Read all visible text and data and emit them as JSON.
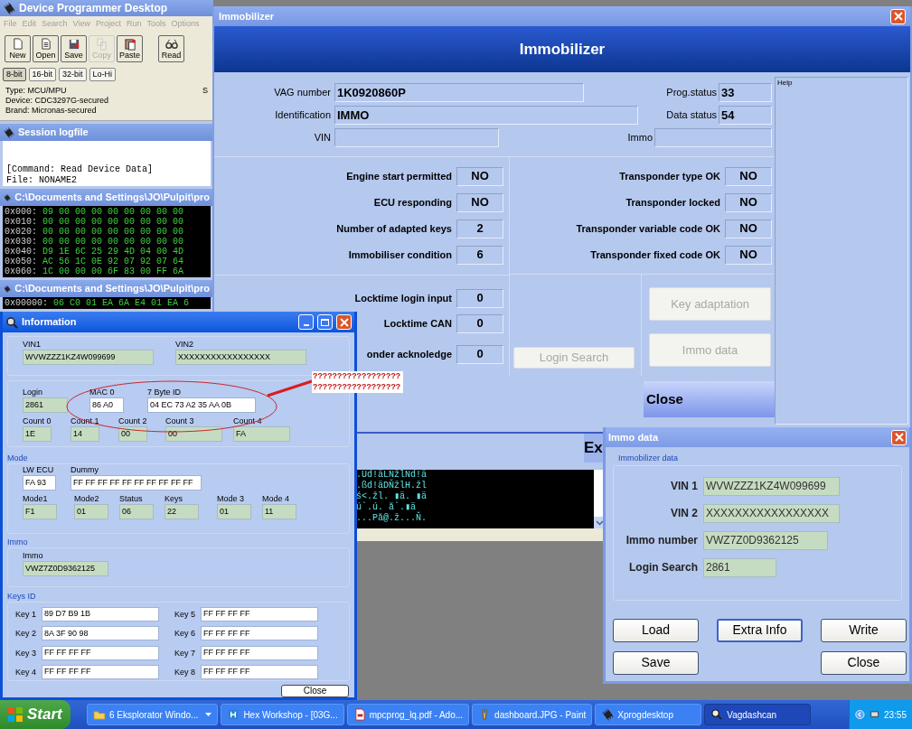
{
  "programmer_window": {
    "title": "Device Programmer Desktop",
    "menu": [
      {
        "label": "File",
        "disabled": true
      },
      {
        "label": "Edit",
        "disabled": true
      },
      {
        "label": "Search",
        "disabled": true
      },
      {
        "label": "View",
        "disabled": true
      },
      {
        "label": "Project",
        "disabled": true
      },
      {
        "label": "Run",
        "disabled": true
      },
      {
        "label": "Tools",
        "disabled": true
      },
      {
        "label": "Options",
        "disabled": true
      }
    ],
    "toolbar": [
      {
        "kind": "new",
        "label": "New",
        "disabled": false
      },
      {
        "kind": "open",
        "label": "Open",
        "disabled": false
      },
      {
        "kind": "save",
        "label": "Save",
        "disabled": false
      },
      {
        "kind": "copy",
        "label": "Copy",
        "disabled": true
      },
      {
        "kind": "paste",
        "label": "Paste",
        "disabled": false
      },
      {
        "kind": "read",
        "label": "Read",
        "disabled": false
      }
    ],
    "width_buttons": [
      {
        "label": "8-bit",
        "selected": true
      },
      {
        "label": "16-bit",
        "selected": false
      },
      {
        "label": "32-bit",
        "selected": false
      },
      {
        "label": "Lo-Hi",
        "selected": false
      }
    ],
    "device_info": [
      "Type: MCU/MPU",
      "Device: CDC3297G-secured",
      "Brand: Micronas-secured"
    ],
    "info_column_2": "S",
    "session_log": {
      "title": "Session logfile",
      "lines": [
        "[Command: Read Device Data]",
        "File: NONAME2"
      ]
    },
    "hex_panels": [
      {
        "title": "C:\\Documents and Settings\\JO\\Pulpit\\pro",
        "rows": [
          {
            "address": "0x000:",
            "bytes": "09 00 00 00 00 00 00 00 00"
          },
          {
            "address": "0x010:",
            "bytes": "00 00 00 00 00 00 00 00 00"
          },
          {
            "address": "0x020:",
            "bytes": "00 00 00 00 00 00 00 00 00"
          },
          {
            "address": "0x030:",
            "bytes": "00 00 00 00 00 00 00 00 00"
          },
          {
            "address": "0x040:",
            "bytes": "D9 1E 6C 25 29 4D 04 00 4D"
          },
          {
            "address": "0x050:",
            "bytes": "AC 56 1C 0E 92 07 92 07 64"
          },
          {
            "address": "0x060:",
            "bytes": "1C 00 00 00 6F 83 00 FF 6A"
          }
        ]
      },
      {
        "title": "C:\\Documents and Settings\\JO\\Pulpit\\pro",
        "rows": [
          {
            "address": "0x00000:",
            "bytes": "06 C0 01 EA 6A E4 01 EA 6"
          }
        ]
      }
    ]
  },
  "immobilizer": {
    "title": "Immobilizer",
    "heading": "Immobilizer",
    "identity": [
      {
        "label": "VAG number",
        "value": "1K0920860P"
      },
      {
        "label": "Identification",
        "value": "IMMO"
      },
      {
        "label": "VIN"
      }
    ],
    "status": [
      {
        "label": "Prog.status",
        "value": "33"
      },
      {
        "label": "Data status",
        "value": "54"
      },
      {
        "label": "Immo"
      }
    ],
    "help": "Help",
    "conditions": [
      {
        "label": "Engine start permitted",
        "value": "NO"
      },
      {
        "label": "ECU responding",
        "value": "NO"
      },
      {
        "label": "Number of adapted keys",
        "value": "2"
      },
      {
        "label": "Immobiliser condition",
        "value": "6"
      }
    ],
    "transponder": [
      {
        "label": "Transponder type OK",
        "value": "NO"
      },
      {
        "label": "Transponder locked",
        "value": "NO"
      },
      {
        "label": "Transponder variable code OK",
        "value": "NO"
      },
      {
        "label": "Transponder fixed code OK",
        "value": "NO"
      }
    ],
    "locktimes": [
      {
        "label": "Locktime login input",
        "value": "0"
      },
      {
        "label": "Locktime CAN",
        "value": "0"
      },
      {
        "label": "onder acknoledge",
        "value": "0"
      }
    ],
    "login_search": {
      "label": "Login Search",
      "disabled": true
    },
    "actions": [
      {
        "label": "Key adaptation",
        "disabled": true
      },
      {
        "label": "Immo data",
        "disabled": true
      }
    ],
    "close": "Close"
  },
  "background_window": {
    "button_cut": "Ex",
    "data_lines": [
      ".Ud!äLNžlNd!ä",
      ".ßd!äDŇžlH.žl",
      "ś<.žl. ▮ä. ▮ä",
      "ú`.ú. ă`.▮ä",
      "...Pă@.ž...Ň."
    ]
  },
  "information_window": {
    "title": "Information",
    "vin": [
      {
        "label": "VIN1",
        "value": "WVWZZZ1KZ4W099699"
      },
      {
        "label": "VIN2",
        "value": "XXXXXXXXXXXXXXXXX"
      }
    ],
    "login": {
      "label": "Login",
      "value": "2861"
    },
    "mac": {
      "label": "MAC 0",
      "value": "86 A0"
    },
    "byte_id": {
      "label": "7 Byte ID",
      "value": "04 EC 73 A2 35 AA 0B"
    },
    "counts": [
      {
        "label": "Count 0",
        "value": "1E"
      },
      {
        "label": "Count 1",
        "value": "14"
      },
      {
        "label": "Count 2",
        "value": "00"
      },
      {
        "label": "Count 3",
        "value": "00"
      },
      {
        "label": "Count 4",
        "value": "FA"
      }
    ],
    "mode": {
      "title": "Mode",
      "lw_ecu": {
        "label": "LW ECU",
        "value": "FA 93"
      },
      "dummy": {
        "label": "Dummy",
        "value": "FF FF FF FF FF FF FF FF FF FF"
      },
      "values": [
        {
          "label": "Mode1",
          "value": "F1"
        },
        {
          "label": "Mode2",
          "value": "01"
        },
        {
          "label": "Status",
          "value": "06"
        },
        {
          "label": "Keys",
          "value": "22"
        },
        {
          "label": "Mode 3",
          "value": "01"
        },
        {
          "label": "Mode 4",
          "value": "11"
        }
      ]
    },
    "immo": {
      "title": "Immo",
      "label": "Immo",
      "value": "VWZ7Z0D9362125"
    },
    "keys": {
      "title": "Keys ID",
      "items": [
        {
          "label": "Key 1",
          "value": "89 D7 B9 1B"
        },
        {
          "label": "Key 2",
          "value": "8A 3F 90 98"
        },
        {
          "label": "Key 3",
          "value": "FF FF FF FF"
        },
        {
          "label": "Key 4",
          "value": "FF FF FF FF"
        },
        {
          "label": "Key 5",
          "value": "FF FF FF FF"
        },
        {
          "label": "Key 6",
          "value": "FF FF FF FF"
        },
        {
          "label": "Key 7",
          "value": "FF FF FF FF"
        },
        {
          "label": "Key 8",
          "value": "FF FF FF FF"
        }
      ]
    },
    "close": "Close"
  },
  "annotation": {
    "lines": [
      "??????????????????",
      "??????????????????"
    ]
  },
  "immo_data_window": {
    "title": "Immo data",
    "group": "Immobilizer data",
    "fields": [
      {
        "label": "VIN 1",
        "value": "WVWZZZ1KZ4W099699"
      },
      {
        "label": "VIN 2",
        "value": "XXXXXXXXXXXXXXXXX"
      },
      {
        "label": "Immo number",
        "value": "VWZ7Z0D9362125"
      },
      {
        "label": "Login Search",
        "value": "2861"
      }
    ],
    "buttons": [
      {
        "label": "Load",
        "focused": false
      },
      {
        "label": "Extra Info",
        "focused": true
      },
      {
        "label": "Write",
        "focused": false
      },
      {
        "label": "Save",
        "focused": false
      },
      {
        "label": "Close",
        "focused": false
      }
    ]
  },
  "taskbar": {
    "start": "Start",
    "items": [
      {
        "kind": "folder",
        "label": "6 Eksplorator Windo...",
        "active": false,
        "grouped": true
      },
      {
        "kind": "hex",
        "label": "Hex Workshop - [03G...",
        "active": false,
        "grouped": false
      },
      {
        "kind": "pdf",
        "label": "mpcprog_lq.pdf - Ado...",
        "active": false,
        "grouped": false
      },
      {
        "kind": "paint",
        "label": "dashboard.JPG - Paint",
        "active": false,
        "grouped": false
      },
      {
        "kind": "chip",
        "label": "Xprogdesktop",
        "active": false,
        "grouped": false
      },
      {
        "kind": "magnifier",
        "label": "Vagdashcan",
        "active": true,
        "grouped": false
      }
    ],
    "clock": "23:55"
  }
}
